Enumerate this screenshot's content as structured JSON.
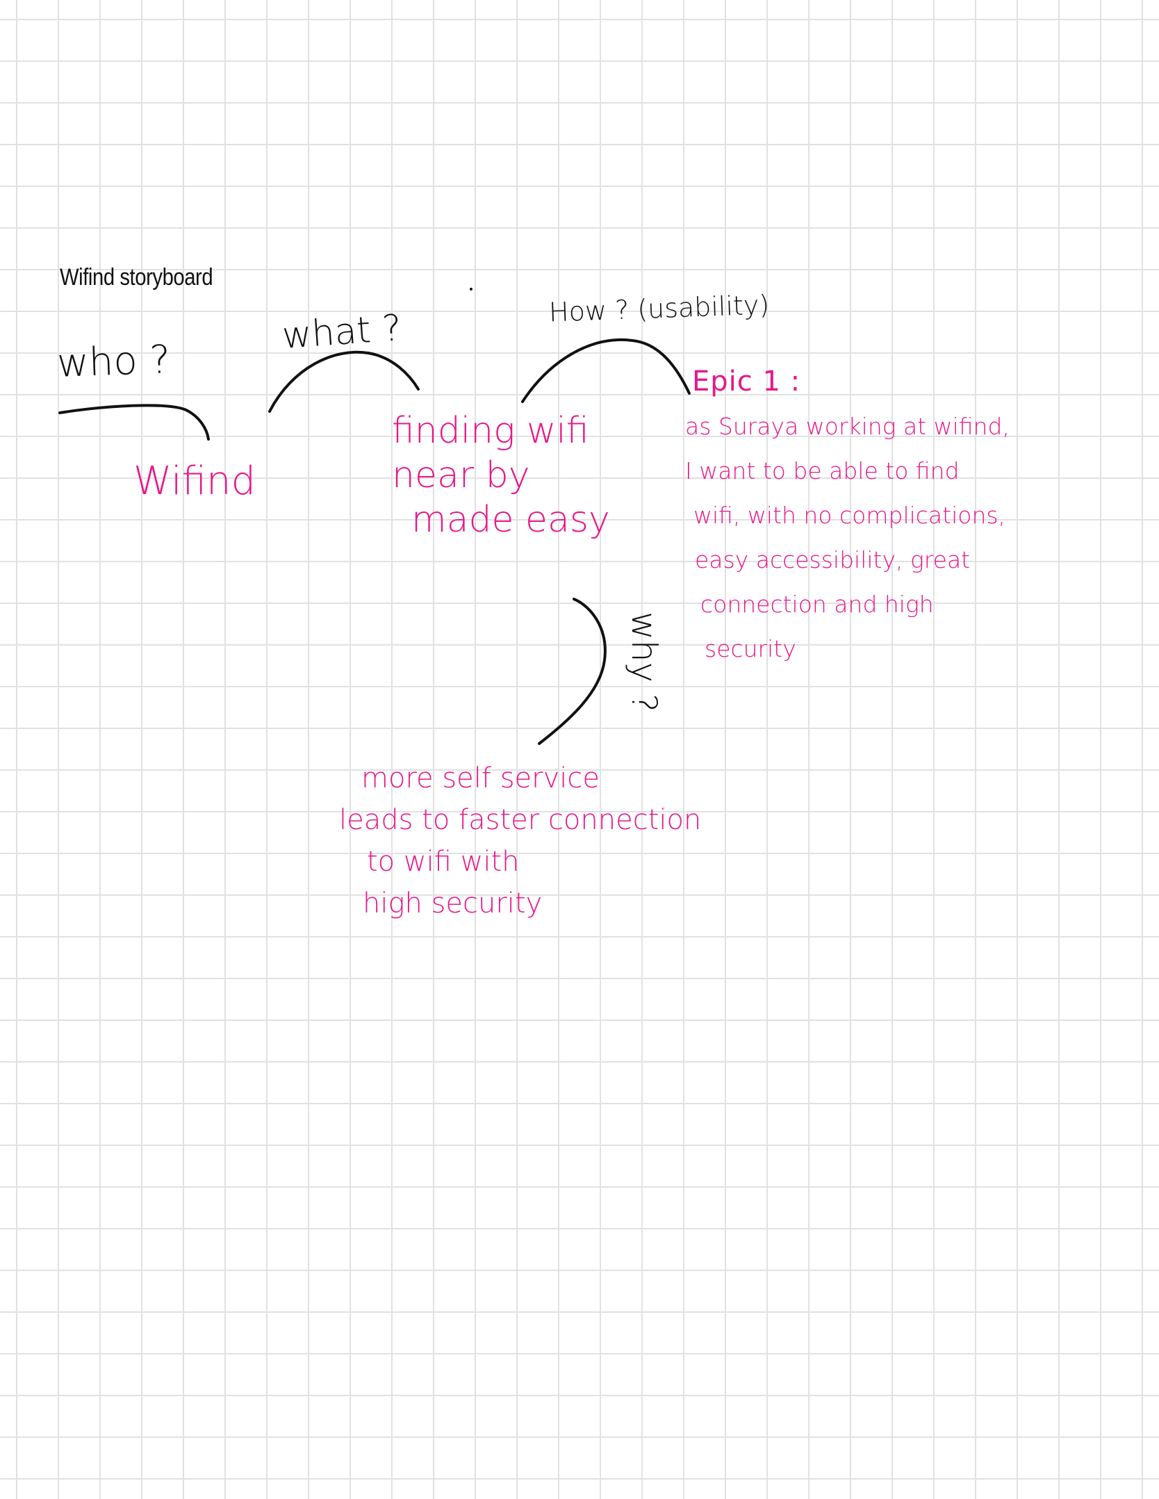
{
  "page": {
    "title": "Wifind storyboard"
  },
  "questions": {
    "who": "who ?",
    "what": "what ?",
    "how": "How ? (usability)",
    "why": "why ?"
  },
  "answers": {
    "who": "Wifind",
    "what": [
      "finding wifi",
      "near by",
      "made easy"
    ],
    "why": [
      "more self service",
      "leads to faster connection",
      "to wifi with",
      "high security"
    ]
  },
  "epic": {
    "heading": "Epic 1 :",
    "lines": [
      "as Suraya working at wifind,",
      "I want to be able to find",
      "wifi, with no complications,",
      "easy accessibility, great",
      "connection and high",
      "security"
    ]
  },
  "colors": {
    "ink": "#111111",
    "accent": "#e8178a",
    "grid": "#e1e1e1"
  }
}
